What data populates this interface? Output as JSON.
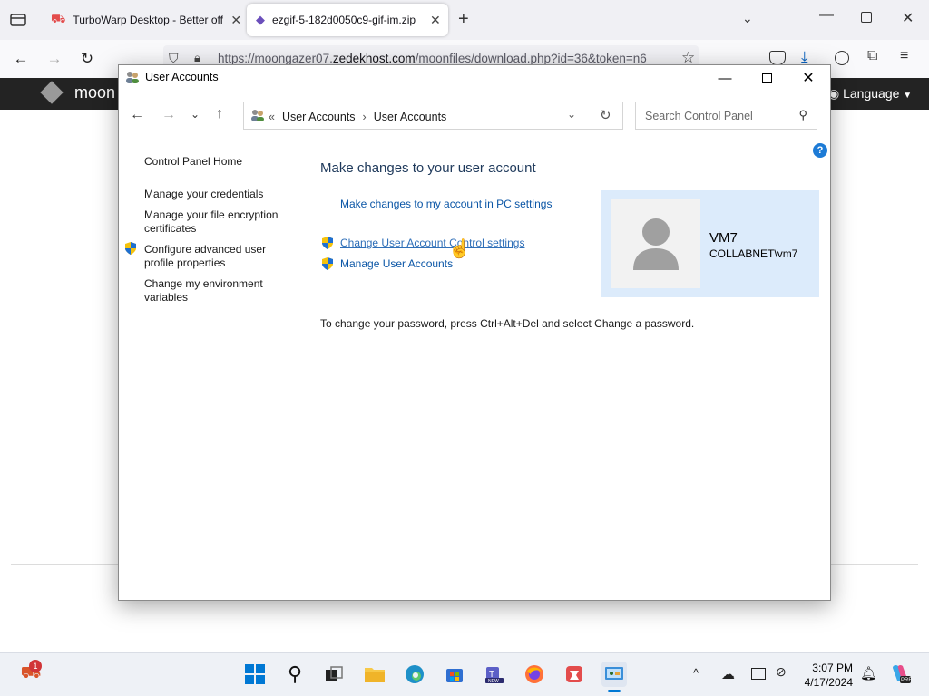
{
  "browser": {
    "tabs": [
      {
        "title": "TurboWarp Desktop - Better off",
        "active": false
      },
      {
        "title": "ezgif-5-182d0050c9-gif-im.zip",
        "active": true
      }
    ],
    "url_prefix": "https://moongazer07.",
    "url_domain": "zedekhost.com",
    "url_rest": "/moonfiles/download.php?id=36&token=n6",
    "site_name": "moon",
    "site_language": "Language"
  },
  "window": {
    "title": "User Accounts",
    "breadcrumb": [
      "User Accounts",
      "User Accounts"
    ],
    "search_placeholder": "Search Control Panel"
  },
  "sidebar": {
    "home": "Control Panel Home",
    "items": [
      "Manage your credentials",
      "Manage your file encryption certificates",
      "Configure advanced user profile properties",
      "Change my environment variables"
    ]
  },
  "main": {
    "heading": "Make changes to your user account",
    "links": [
      "Make changes to my account in PC settings",
      "Change User Account Control settings",
      "Manage User Accounts"
    ],
    "password_note": "To change your password, press Ctrl+Alt+Del and select Change a password."
  },
  "user": {
    "name": "VM7",
    "domain": "COLLABNET\\vm7"
  },
  "taskbar": {
    "time": "3:07 PM",
    "date": "4/17/2024",
    "notification_count": "1"
  },
  "colors": {
    "link": "#0b56a6",
    "heading": "#1e395b",
    "card": "#dcebfb",
    "accent": "#0078d4"
  }
}
